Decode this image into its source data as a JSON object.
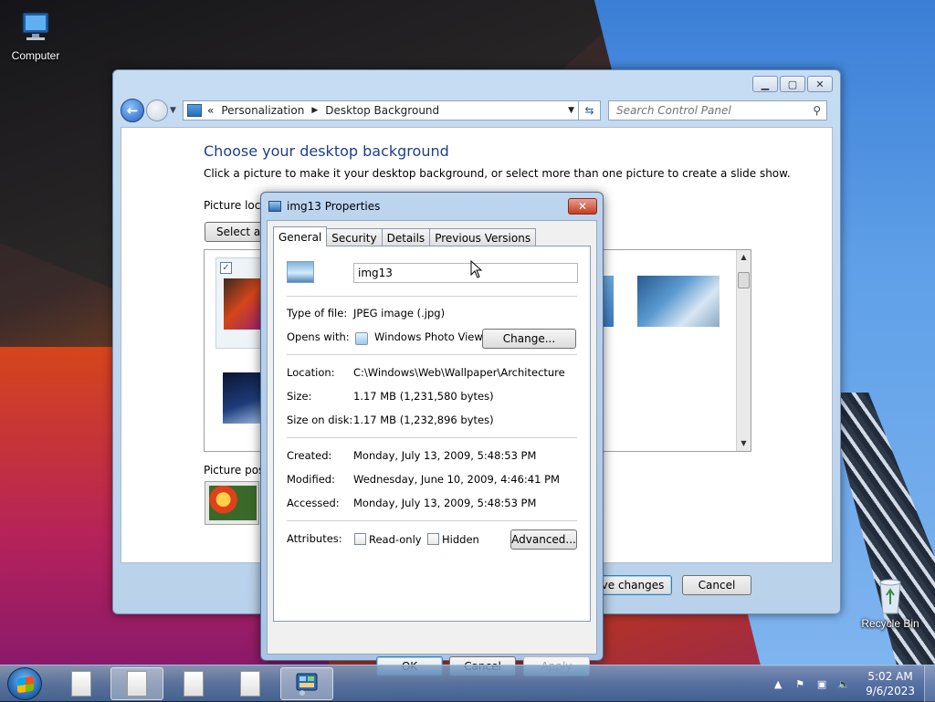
{
  "desktop": {
    "computer_label": "Computer",
    "recycle_label": "Recycle Bin"
  },
  "explorer": {
    "breadcrumb": [
      "Personalization",
      "Desktop Background"
    ],
    "breadcrumb_prefix": "«",
    "search_placeholder": "Search Control Panel",
    "title": "Choose your desktop background",
    "description": "Click a picture to make it your desktop background, or select more than one picture to create a slide show.",
    "picture_location_label": "Picture loca",
    "select_all_label": "Select all",
    "picture_position_label": "Picture posi",
    "save_label": "ve changes",
    "cancel_label": "Cancel"
  },
  "dialog": {
    "title": "img13 Properties",
    "tabs": [
      "General",
      "Security",
      "Details",
      "Previous Versions"
    ],
    "filename": "img13",
    "type_label": "Type of file:",
    "type_value": "JPEG image (.jpg)",
    "opens_label": "Opens with:",
    "opens_value": "Windows Photo Viewer",
    "change_label": "Change...",
    "location_label": "Location:",
    "location_value": "C:\\Windows\\Web\\Wallpaper\\Architecture",
    "size_label": "Size:",
    "size_value": "1.17 MB (1,231,580 bytes)",
    "disk_label": "Size on disk:",
    "disk_value": "1.17 MB (1,232,896 bytes)",
    "created_label": "Created:",
    "created_value": "Monday, July 13, 2009, 5:48:53 PM",
    "modified_label": "Modified:",
    "modified_value": "Wednesday, June 10, 2009, 4:46:41 PM",
    "accessed_label": "Accessed:",
    "accessed_value": "Monday, July 13, 2009, 5:48:53 PM",
    "attributes_label": "Attributes:",
    "readonly_label": "Read-only",
    "hidden_label": "Hidden",
    "advanced_label": "Advanced...",
    "ok_label": "OK",
    "cancel_label": "Cancel",
    "apply_label": "Apply"
  },
  "taskbar": {
    "time": "5:02 AM",
    "date": "9/6/2023"
  }
}
